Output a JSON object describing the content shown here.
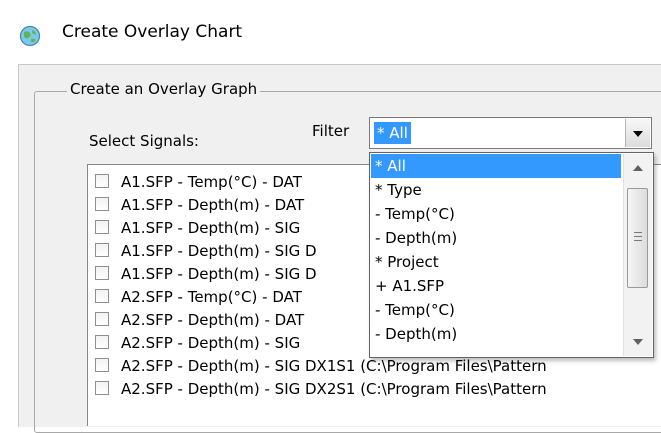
{
  "window": {
    "title": "Create Overlay Chart",
    "icon": "globe-icon"
  },
  "group": {
    "title": "Create an Overlay Graph"
  },
  "select_signals_label": "Select Signals:",
  "filter": {
    "label": "Filter",
    "selected": "* All",
    "options": [
      "* All",
      "* Type",
      "- Temp(°C)",
      "- Depth(m)",
      "* Project",
      "+ A1.SFP",
      "- Temp(°C)",
      "- Depth(m)"
    ]
  },
  "signals": [
    {
      "label": "A1.SFP - Temp(°C) - DAT",
      "checked": false
    },
    {
      "label": "A1.SFP - Depth(m) - DAT",
      "checked": false
    },
    {
      "label": "A1.SFP - Depth(m) - SIG",
      "checked": false
    },
    {
      "label": "A1.SFP - Depth(m) - SIG D",
      "checked": false
    },
    {
      "label": "A1.SFP - Depth(m) - SIG D",
      "checked": false
    },
    {
      "label": "A2.SFP - Temp(°C) - DAT",
      "checked": false
    },
    {
      "label": "A2.SFP - Depth(m) - DAT",
      "checked": false
    },
    {
      "label": "A2.SFP - Depth(m) - SIG",
      "checked": false
    },
    {
      "label": "A2.SFP - Depth(m) - SIG DX1S1 (C:\\Program Files\\Pattern",
      "checked": false
    },
    {
      "label": "A2.SFP - Depth(m) - SIG DX2S1 (C:\\Program Files\\Pattern",
      "checked": false
    }
  ],
  "colors": {
    "selection": "#3399ff",
    "dialog_bg": "#f0f0f0"
  }
}
